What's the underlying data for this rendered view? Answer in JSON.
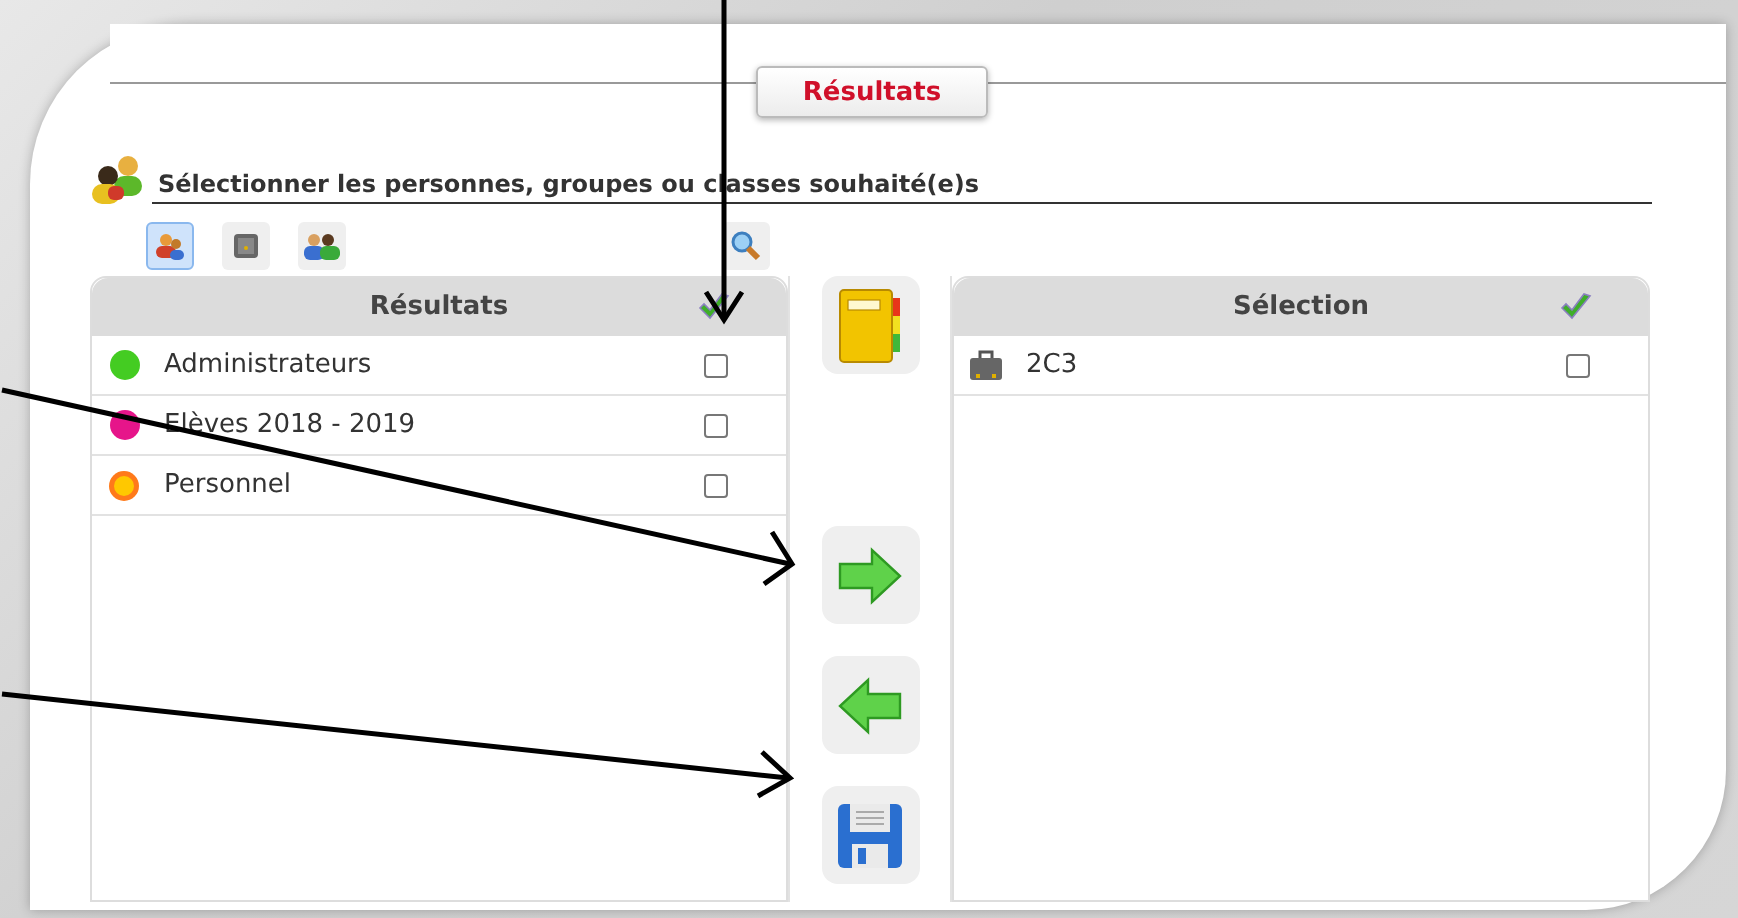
{
  "tab": {
    "label": "Résultats"
  },
  "heading": "Sélectionner les personnes, groupes ou classes souhaité(e)s",
  "filters": [
    {
      "kind": "people",
      "selected": true
    },
    {
      "kind": "classes",
      "selected": false
    },
    {
      "kind": "groups",
      "selected": false
    }
  ],
  "results": {
    "title": "Résultats",
    "items": [
      {
        "name": "Administrateurs",
        "kind": "dot",
        "color": "#44cc22",
        "checked": false
      },
      {
        "name": "Elèves 2018 - 2019",
        "kind": "dot",
        "color": "#e6158a",
        "checked": false
      },
      {
        "name": "Personnel",
        "kind": "sun",
        "checked": false
      }
    ]
  },
  "actions": [
    {
      "kind": "notebook"
    },
    {
      "kind": "add"
    },
    {
      "kind": "remove"
    },
    {
      "kind": "save"
    }
  ],
  "selection": {
    "title": "Sélection",
    "items": [
      {
        "name": "2C3",
        "kind": "class",
        "checked": false
      }
    ]
  }
}
